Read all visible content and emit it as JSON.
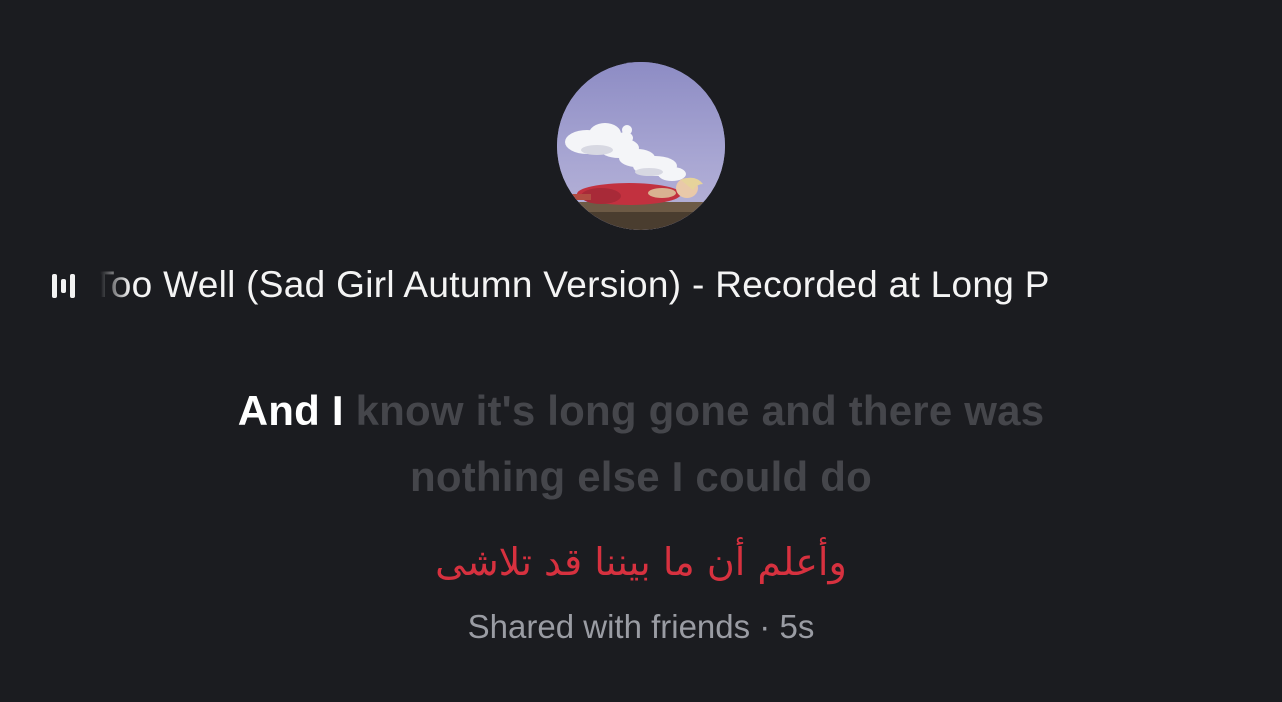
{
  "now_playing": {
    "icon": "now-playing-bars-icon",
    "track_title": "Too Well (Sad Girl Autumn Version) - Recorded at Long P"
  },
  "album_art": {
    "icon": "album-cover-image"
  },
  "lyrics": {
    "sung": "And I",
    "unsung": "know it's long gone and there was nothing else I could do"
  },
  "translation": {
    "text": "وأعلم أن ما بيننا قد تلاشى"
  },
  "meta": {
    "shared_text": "Shared with friends · 5s"
  },
  "colors": {
    "background": "#1b1c20",
    "sung": "#ffffff",
    "unsung": "#45464b",
    "translation": "#d7313f",
    "meta": "#9a9ca3"
  }
}
